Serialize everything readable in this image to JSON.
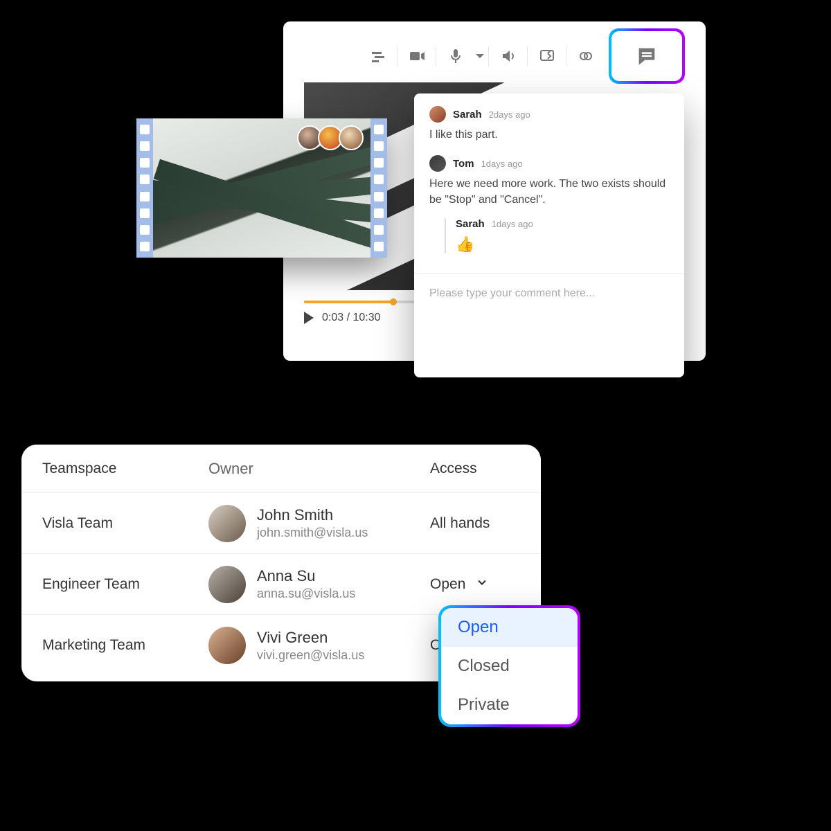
{
  "editor": {
    "toolbar_icons": [
      "sliders-icon",
      "video-icon",
      "mic-icon",
      "mic-caret-icon",
      "speaker-icon",
      "screen-share-icon",
      "link-icon",
      "comments-icon"
    ],
    "playtime": "0:03 / 10:30"
  },
  "filmstrip": {
    "members": [
      "member-1",
      "member-2",
      "member-3"
    ]
  },
  "comments": {
    "items": [
      {
        "avatar": "a1",
        "name": "Sarah",
        "time": "2days ago",
        "text": "I like this part."
      },
      {
        "avatar": "a2",
        "name": "Tom",
        "time": "1days ago",
        "text": "Here we need more work. The two exists should be \"Stop\" and \"Cancel\".",
        "reply": {
          "name": "Sarah",
          "time": "1days ago",
          "emoji": "👍"
        }
      }
    ],
    "placeholder": "Please type your comment here..."
  },
  "table": {
    "headers": {
      "teamspace": "Teamspace",
      "owner": "Owner",
      "access": "Access"
    },
    "rows": [
      {
        "team": "Visla Team",
        "owner_name": "John Smith",
        "owner_email": "john.smith@visla.us",
        "access": "All hands",
        "avatar": "o1",
        "chevron": false
      },
      {
        "team": "Engineer Team",
        "owner_name": "Anna Su",
        "owner_email": "anna.su@visla.us",
        "access": "Open",
        "avatar": "o2",
        "chevron": true
      },
      {
        "team": "Marketing Team",
        "owner_name": "Vivi Green",
        "owner_email": "vivi.green@visla.us",
        "access": "O",
        "avatar": "o3",
        "chevron": false
      }
    ]
  },
  "dropdown": {
    "options": [
      {
        "label": "Open",
        "selected": true
      },
      {
        "label": "Closed",
        "selected": false
      },
      {
        "label": "Private",
        "selected": false
      }
    ]
  }
}
